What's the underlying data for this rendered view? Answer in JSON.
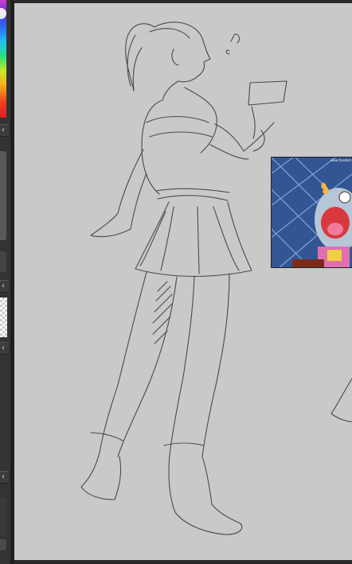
{
  "app": {
    "colors": {
      "canvas_bg": "#c9c9c9",
      "frame_bg": "#2b2b2b",
      "panel_bg": "#333333",
      "sketch_stroke": "#4a4a4a"
    }
  },
  "panels": [
    {
      "name": "color-picker",
      "icon": "hue-slider"
    },
    {
      "name": "panel-2",
      "icon": "chevron-left-icon"
    },
    {
      "name": "layer-preview",
      "icon": "chevron-left-icon"
    },
    {
      "name": "panel-4",
      "icon": "chevron-left-icon"
    },
    {
      "name": "panel-5",
      "icon": "chevron-left-icon"
    }
  ],
  "canvas": {
    "reference_image": {
      "watermark": "www.fandom"
    }
  }
}
